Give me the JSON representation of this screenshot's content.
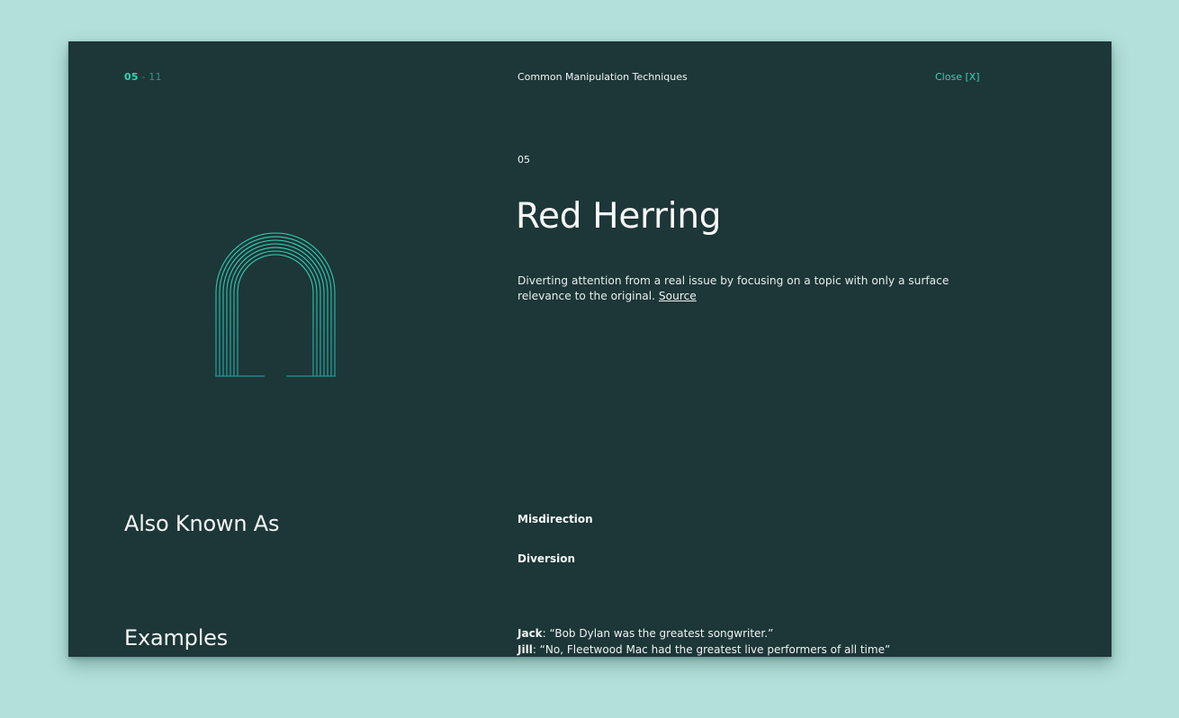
{
  "header": {
    "counter_current": "05",
    "counter_separator": " - ",
    "counter_total": "11",
    "title": "Common Manipulation Techniques",
    "close_label": "Close [X]"
  },
  "technique": {
    "index": "05",
    "title": "Red Herring",
    "description": "Diverting attention from a real issue by focusing on a topic with only a surface relevance to the original.",
    "source_label": "Source",
    "illustration_icon": "nested-arch-icon"
  },
  "also_known_as": {
    "heading": "Also Known As",
    "items": [
      "Misdirection",
      "Diversion"
    ]
  },
  "examples": {
    "heading": "Examples",
    "lines": [
      {
        "speaker": "Jack",
        "text": ": “Bob Dylan was the greatest songwriter.”"
      },
      {
        "speaker": "Jill",
        "text": ": “No, Fleetwood Mac had the greatest live performers of all time”"
      }
    ]
  },
  "colors": {
    "page_background": "#b3e0d9",
    "modal_background": "#1d3638",
    "accent": "#2fd6b5",
    "accent_dim": "#1f9c86"
  }
}
